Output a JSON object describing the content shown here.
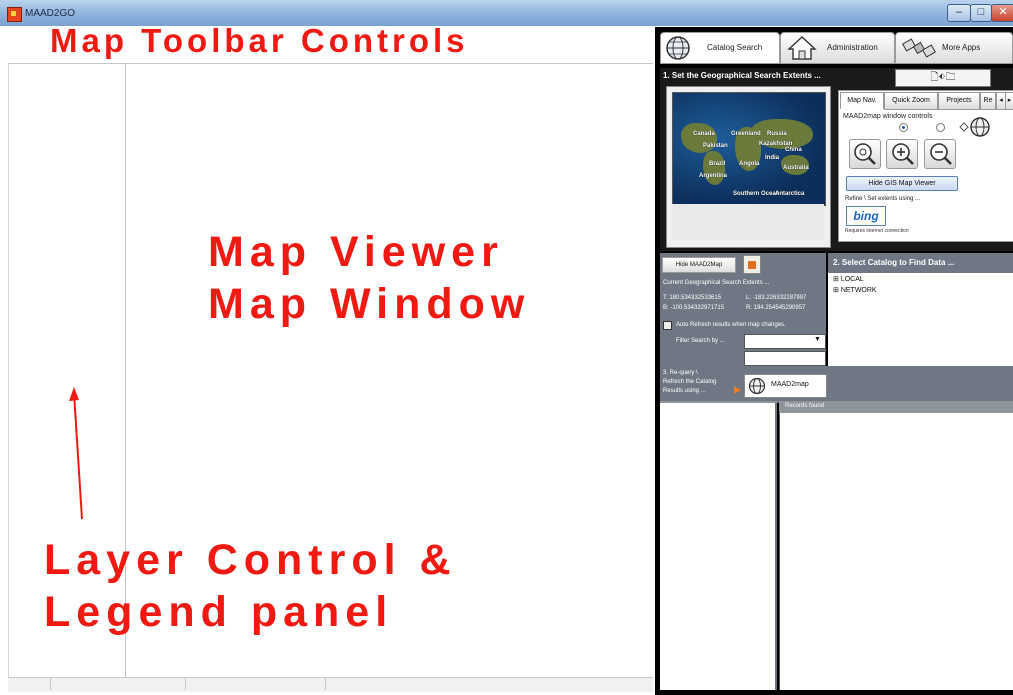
{
  "window": {
    "title": "MAAD2GO",
    "minimize": "–",
    "maximize": "□",
    "close": "✕"
  },
  "annotations": {
    "toolbar": "Map Toolbar Controls",
    "viewer_line1": "Map Viewer",
    "viewer_line2": "Map Window",
    "layer_line1": "Layer Control &",
    "layer_line2": "Legend panel"
  },
  "tabs": [
    {
      "label": "Catalog Search",
      "icon": "globe-icon"
    },
    {
      "label": "Administration",
      "icon": "house-icon"
    },
    {
      "label": "More Apps",
      "icon": "satellite-icon"
    }
  ],
  "section1": {
    "title": "1. Set the Geographical Search Extents ...",
    "map_labels": [
      "Canada",
      "Greenland",
      "Russia",
      "Kazakhstan",
      "China",
      "Pakistan",
      "India",
      "Brazil",
      "Angola",
      "Australia",
      "Argentina",
      "Southern Ocean",
      "Antarctica"
    ]
  },
  "map_nav": {
    "tabs": [
      "Map Nav.",
      "Quick Zoom",
      "Projects",
      "Re"
    ],
    "controls_label": "MAAD2map window controls",
    "hide_gis_label": "Hide GIS Map Viewer",
    "refine_label": "Refine \\ Set extents using ...",
    "bing_label": "bing",
    "internet_label": "Requires internet connection"
  },
  "section2": {
    "hide_maad_label": "Hide MAAD2Map",
    "extents_label": "Current Geographical Search Extents ...",
    "coord_t": "T: 180.534332533615",
    "coord_l": "L: -183.226332287997",
    "coord_b": "B: -100.534332971715",
    "coord_r": "R: 194.254545290957",
    "auto_refresh_label": "Auto Refresh results when map changes.",
    "filter_label": "Filter Search by ...",
    "requery_line1": "3. Re-query \\",
    "requery_line2": "Refresh the Catalog",
    "requery_line3": "Results using ...",
    "maad2map_label": "MAAD2map"
  },
  "catalog": {
    "title": "2. Select Catalog to Find Data ...",
    "items": [
      "LOCAL",
      "NETWORK"
    ]
  },
  "results": {
    "records_label": "Records found"
  }
}
